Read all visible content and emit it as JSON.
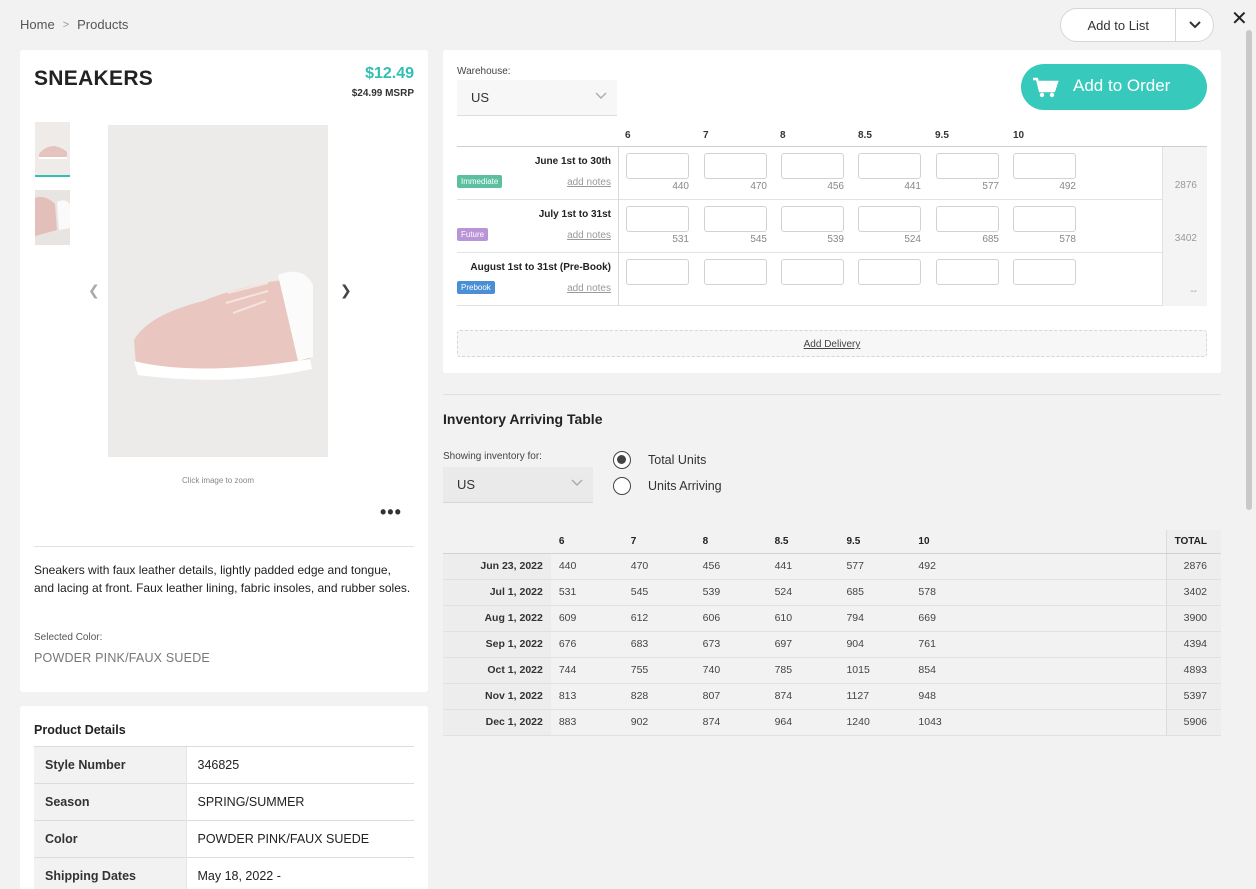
{
  "breadcrumb": {
    "home": "Home",
    "sep": ">",
    "current": "Products"
  },
  "header": {
    "add_to_list": "Add to List"
  },
  "product": {
    "title": "SNEAKERS",
    "price": "$12.49",
    "msrp": "$24.99 MSRP",
    "zoom_hint": "Click image to zoom",
    "more": "•••",
    "description": "Sneakers with faux leather details, lightly padded edge and tongue, and lacing at front. Faux leather lining, fabric insoles, and rubber soles.",
    "selected_color_label": "Selected Color:",
    "selected_color": "POWDER PINK/FAUX SUEDE"
  },
  "details": {
    "title": "Product Details",
    "rows": [
      {
        "k": "Style Number",
        "v": "346825"
      },
      {
        "k": "Season",
        "v": "SPRING/SUMMER"
      },
      {
        "k": "Color",
        "v": "POWDER PINK/FAUX SUEDE"
      },
      {
        "k": "Shipping Dates",
        "v": "May 18, 2022 -"
      }
    ]
  },
  "order": {
    "warehouse_label": "Warehouse:",
    "warehouse": "US",
    "add_to_order": "Add to Order",
    "sizes": [
      "6",
      "7",
      "8",
      "8.5",
      "9.5",
      "10"
    ],
    "deliveries": [
      {
        "label": "June 1st to 30th",
        "badge": "Immediate",
        "badge_color": "#5bc0a0",
        "notes": "add notes",
        "avail": [
          "440",
          "470",
          "456",
          "441",
          "577",
          "492"
        ],
        "total": "2876"
      },
      {
        "label": "July 1st to 31st",
        "badge": "Future",
        "badge_color": "#b994d6",
        "notes": "add notes",
        "avail": [
          "531",
          "545",
          "539",
          "524",
          "685",
          "578"
        ],
        "total": "3402"
      },
      {
        "label": "August 1st to 31st (Pre-Book)",
        "badge": "Prebook",
        "badge_color": "#4a8fd6",
        "notes": "add notes",
        "avail": [
          "",
          "",
          "",
          "",
          "",
          ""
        ],
        "total": "--"
      }
    ],
    "add_delivery": "Add Delivery"
  },
  "inventory": {
    "title": "Inventory Arriving Table",
    "showing_label": "Showing inventory for:",
    "region": "US",
    "radio_total": "Total Units",
    "radio_arriving": "Units Arriving",
    "columns": [
      "6",
      "7",
      "8",
      "8.5",
      "9.5",
      "10"
    ],
    "total_header": "TOTAL",
    "rows": [
      {
        "date": "Jun 23, 2022",
        "vals": [
          "440",
          "470",
          "456",
          "441",
          "577",
          "492"
        ],
        "total": "2876"
      },
      {
        "date": "Jul 1, 2022",
        "vals": [
          "531",
          "545",
          "539",
          "524",
          "685",
          "578"
        ],
        "total": "3402"
      },
      {
        "date": "Aug 1, 2022",
        "vals": [
          "609",
          "612",
          "606",
          "610",
          "794",
          "669"
        ],
        "total": "3900"
      },
      {
        "date": "Sep 1, 2022",
        "vals": [
          "676",
          "683",
          "673",
          "697",
          "904",
          "761"
        ],
        "total": "4394"
      },
      {
        "date": "Oct 1, 2022",
        "vals": [
          "744",
          "755",
          "740",
          "785",
          "1015",
          "854"
        ],
        "total": "4893"
      },
      {
        "date": "Nov 1, 2022",
        "vals": [
          "813",
          "828",
          "807",
          "874",
          "1127",
          "948"
        ],
        "total": "5397"
      },
      {
        "date": "Dec 1, 2022",
        "vals": [
          "883",
          "902",
          "874",
          "964",
          "1240",
          "1043"
        ],
        "total": "5906"
      }
    ]
  }
}
